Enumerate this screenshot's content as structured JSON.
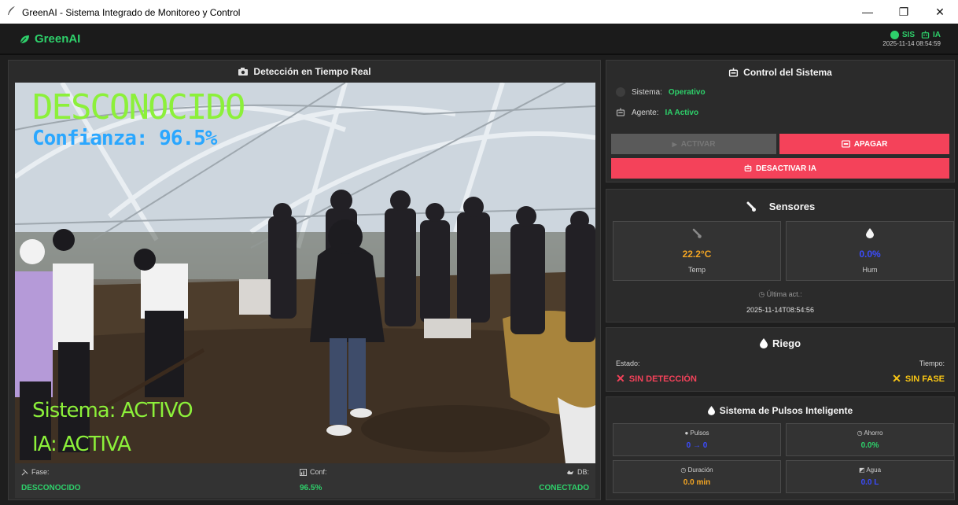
{
  "window": {
    "title": "GreenAI - Sistema Integrado de Monitoreo y Control",
    "minimize_glyph": "—",
    "restore_glyph": "❐",
    "close_glyph": "✕"
  },
  "header": {
    "brand": "GreenAI",
    "sis_label": "SIS",
    "ia_label": "IA",
    "timestamp": "2025-11-14 08:54:59"
  },
  "camera": {
    "title": "Detección en Tiempo Real",
    "overlay_class": "DESCONOCIDO",
    "overlay_conf": "Confianza: 96.5%",
    "overlay_system": "Sistema: ACTIVO",
    "overlay_ia": "IA: ACTIVA",
    "footer": {
      "fase_label": "Fase:",
      "fase_value": "DESCONOCIDO",
      "conf_label": "Conf:",
      "conf_value": "96.5%",
      "db_label": "DB:",
      "db_value": "CONECTADO"
    }
  },
  "control": {
    "title": "Control del Sistema",
    "sistema_label": "Sistema:",
    "sistema_value": "Operativo",
    "agente_label": "Agente:",
    "agente_value": "IA Activo",
    "btn_activar": "ACTIVAR",
    "btn_apagar": "APAGAR",
    "btn_desactivar": "DESACTIVAR IA"
  },
  "sensors": {
    "title": "Sensores",
    "temp_value": "22.2°C",
    "temp_label": "Temp",
    "hum_value": "0.0%",
    "hum_label": "Hum",
    "last_update_label": "Última act.:",
    "last_update_value": "2025-11-14T08:54:56"
  },
  "riego": {
    "title": "Riego",
    "estado_label": "Estado:",
    "estado_value": "SIN DETECCIÓN",
    "tiempo_label": "Tiempo:",
    "tiempo_value": "SIN FASE"
  },
  "pulsos": {
    "title": "Sistema de Pulsos Inteligente",
    "pulsos_label": "Pulsos",
    "pulsos_value": "0 → 0",
    "ahorro_label": "Ahorro",
    "ahorro_value": "0.0%",
    "duracion_label": "Duración",
    "duracion_value": "0.0 min",
    "agua_label": "Agua",
    "agua_value": "0.0 L"
  },
  "colors": {
    "accent_green": "#2ed16b",
    "danger_red": "#f4425a",
    "temp_orange": "#f5a623",
    "hum_blue": "#3b4cff",
    "warn_yellow": "#f7c515"
  },
  "icons": {
    "brand": "leaf-icon",
    "camera": "camera-icon",
    "control": "robot-icon",
    "sensors": "thermometer-icon",
    "riego": "water-drop-icon"
  }
}
